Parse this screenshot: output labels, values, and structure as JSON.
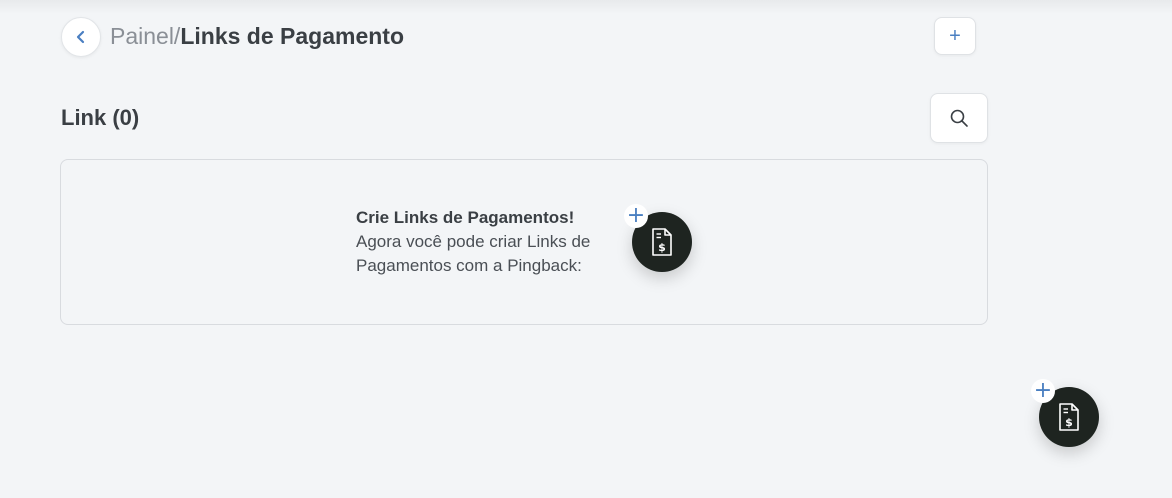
{
  "header": {
    "breadcrumb_parent": "Painel/",
    "breadcrumb_current": "Links de Pagamento",
    "add_label": "+"
  },
  "section": {
    "title": "Link (0)"
  },
  "empty_state": {
    "heading": "Crie Links de Pagamentos!",
    "body": "Agora você pode criar Links de Pagamentos com a Pingback:",
    "add_label": "+"
  },
  "floating_action": {
    "add_label": "+"
  },
  "icons": {
    "back": "chevron-left-icon",
    "search": "search-icon",
    "document": "payment-document-icon",
    "plus": "plus-icon"
  },
  "colors": {
    "accent": "#4a7fc1",
    "fab_background": "#1e2420",
    "page_background": "#f3f5f7",
    "text_dark": "#3a3f44",
    "text_muted": "#8a8f96"
  }
}
